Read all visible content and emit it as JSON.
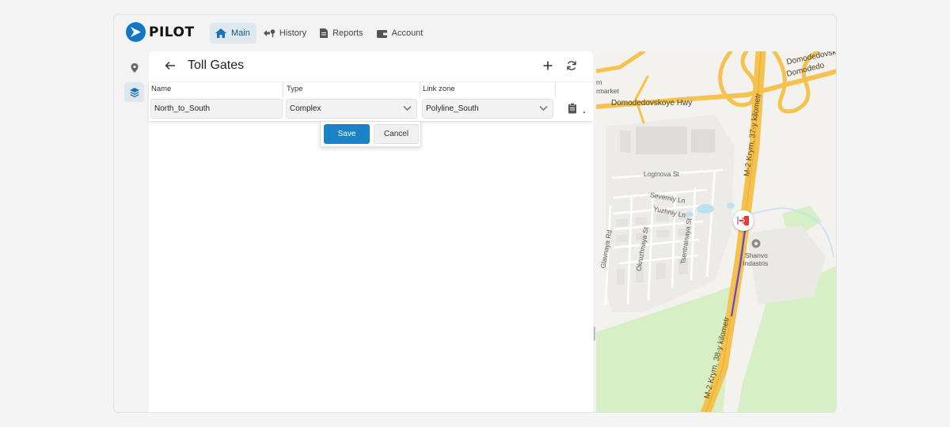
{
  "app": {
    "logo_text": "PILOT",
    "brand_color": "#1477c6"
  },
  "nav": {
    "items": [
      {
        "label": "Main",
        "icon": "home-icon",
        "active": true
      },
      {
        "label": "History",
        "icon": "history-icon",
        "active": false
      },
      {
        "label": "Reports",
        "icon": "document-icon",
        "active": false
      },
      {
        "label": "Account",
        "icon": "wallet-icon",
        "active": false
      }
    ]
  },
  "sidebar": {
    "items": [
      {
        "icon": "location-pin-icon",
        "active": false
      },
      {
        "icon": "layers-icon",
        "active": true
      }
    ]
  },
  "panel": {
    "title": "Toll Gates",
    "columns": [
      "Name",
      "Type",
      "Link zone"
    ],
    "row": {
      "name": "North_to_South",
      "type": "Complex",
      "link_zone": "Polyline_South"
    },
    "save_label": "Save",
    "cancel_label": "Cancel",
    "accent": "#1a82c6"
  },
  "map": {
    "labels": {
      "rn": "rn",
      "market": "rmarket",
      "domodedovskoye": "Domodedovskoye Hwy",
      "domodedovsk_top": "Domodedovsk",
      "domodedovo_right": "Domodedo",
      "loginova": "Loginova St",
      "severniy": "Severniy Ln",
      "yuzhniy": "Yuzhniy Ln",
      "glavnaya": "Glavnaya Rd",
      "okruzhnaya": "Okruzhnaya St",
      "tsentralnaya": "Tsentralnaya St",
      "krym37": "M-2 Krym, 37-y kilometr",
      "krym38": "M-2 Krym, 38-y kilometr",
      "shanvo": "Shanvo",
      "indastris": "Indastris"
    },
    "road_color": "#f5c250",
    "forest_color": "#d6efc4",
    "route_color": "#5a4ad6",
    "marker_color": "#e53935"
  }
}
